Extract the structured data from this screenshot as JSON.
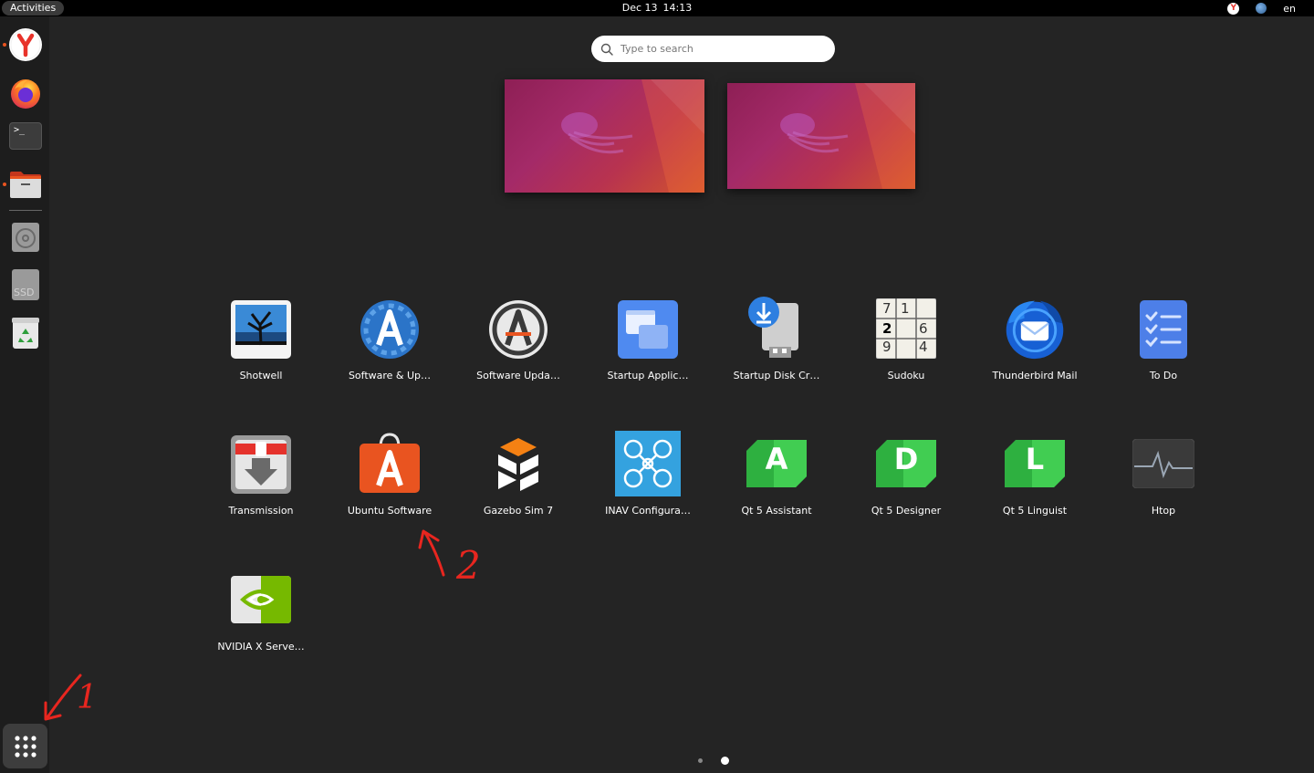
{
  "topbar": {
    "activities": "Activities",
    "date": "Dec 13",
    "time": "14:13",
    "yandex_icon_letter": "Y",
    "language": "en"
  },
  "search": {
    "placeholder": "Type to search",
    "value": ""
  },
  "dock": {
    "items": [
      {
        "name": "yandex-browser",
        "icon": "yandex-icon",
        "running": true
      },
      {
        "name": "firefox",
        "icon": "firefox-icon",
        "running": false
      },
      {
        "name": "terminal",
        "icon": "terminal-icon",
        "running": false
      },
      {
        "name": "files",
        "icon": "folder-icon",
        "running": true
      },
      {
        "name": "optical-drive",
        "icon": "disc-icon",
        "running": false
      },
      {
        "name": "ssd-drive",
        "icon": "ssd-icon",
        "label": "SSD",
        "running": false
      },
      {
        "name": "trash",
        "icon": "trash-icon",
        "running": false
      }
    ],
    "terminal_glyph": ">_"
  },
  "apps": {
    "row1": [
      {
        "label": "Shotwell",
        "icon": "shotwell-icon"
      },
      {
        "label": "Software & Up…",
        "icon": "software-properties-icon"
      },
      {
        "label": "Software Upda…",
        "icon": "software-updater-icon"
      },
      {
        "label": "Startup Applic…",
        "icon": "startup-applications-icon"
      },
      {
        "label": "Startup Disk Cr…",
        "icon": "startup-disk-creator-icon"
      },
      {
        "label": "Sudoku",
        "icon": "sudoku-icon"
      },
      {
        "label": "Thunderbird Mail",
        "icon": "thunderbird-icon"
      },
      {
        "label": "To Do",
        "icon": "todo-icon"
      }
    ],
    "row2": [
      {
        "label": "Transmission",
        "icon": "transmission-icon"
      },
      {
        "label": "Ubuntu Software",
        "icon": "ubuntu-software-icon"
      },
      {
        "label": "Gazebo Sim 7",
        "icon": "gazebo-icon"
      },
      {
        "label": "INAV Configura…",
        "icon": "inav-icon"
      },
      {
        "label": "Qt 5 Assistant",
        "icon": "qt-assistant-icon"
      },
      {
        "label": "Qt 5 Designer",
        "icon": "qt-designer-icon"
      },
      {
        "label": "Qt 5 Linguist",
        "icon": "qt-linguist-icon"
      },
      {
        "label": "Htop",
        "icon": "htop-icon"
      }
    ],
    "row3": [
      {
        "label": "NVIDIA X Serve…",
        "icon": "nvidia-icon"
      }
    ]
  },
  "icon_letters": {
    "qt_assistant": "A",
    "qt_designer": "D",
    "qt_linguist": "L",
    "software_a": "A"
  },
  "sudoku_digits": [
    "7",
    "1",
    "2",
    "6",
    "9",
    "4"
  ],
  "annotations": {
    "mark_1": "1",
    "mark_2": "2"
  },
  "colors": {
    "ubuntu_orange": "#e95420",
    "qt_green": "#41cd52",
    "annotation_red": "#e8261f"
  },
  "pagination": {
    "pages": 2,
    "current": 2
  }
}
